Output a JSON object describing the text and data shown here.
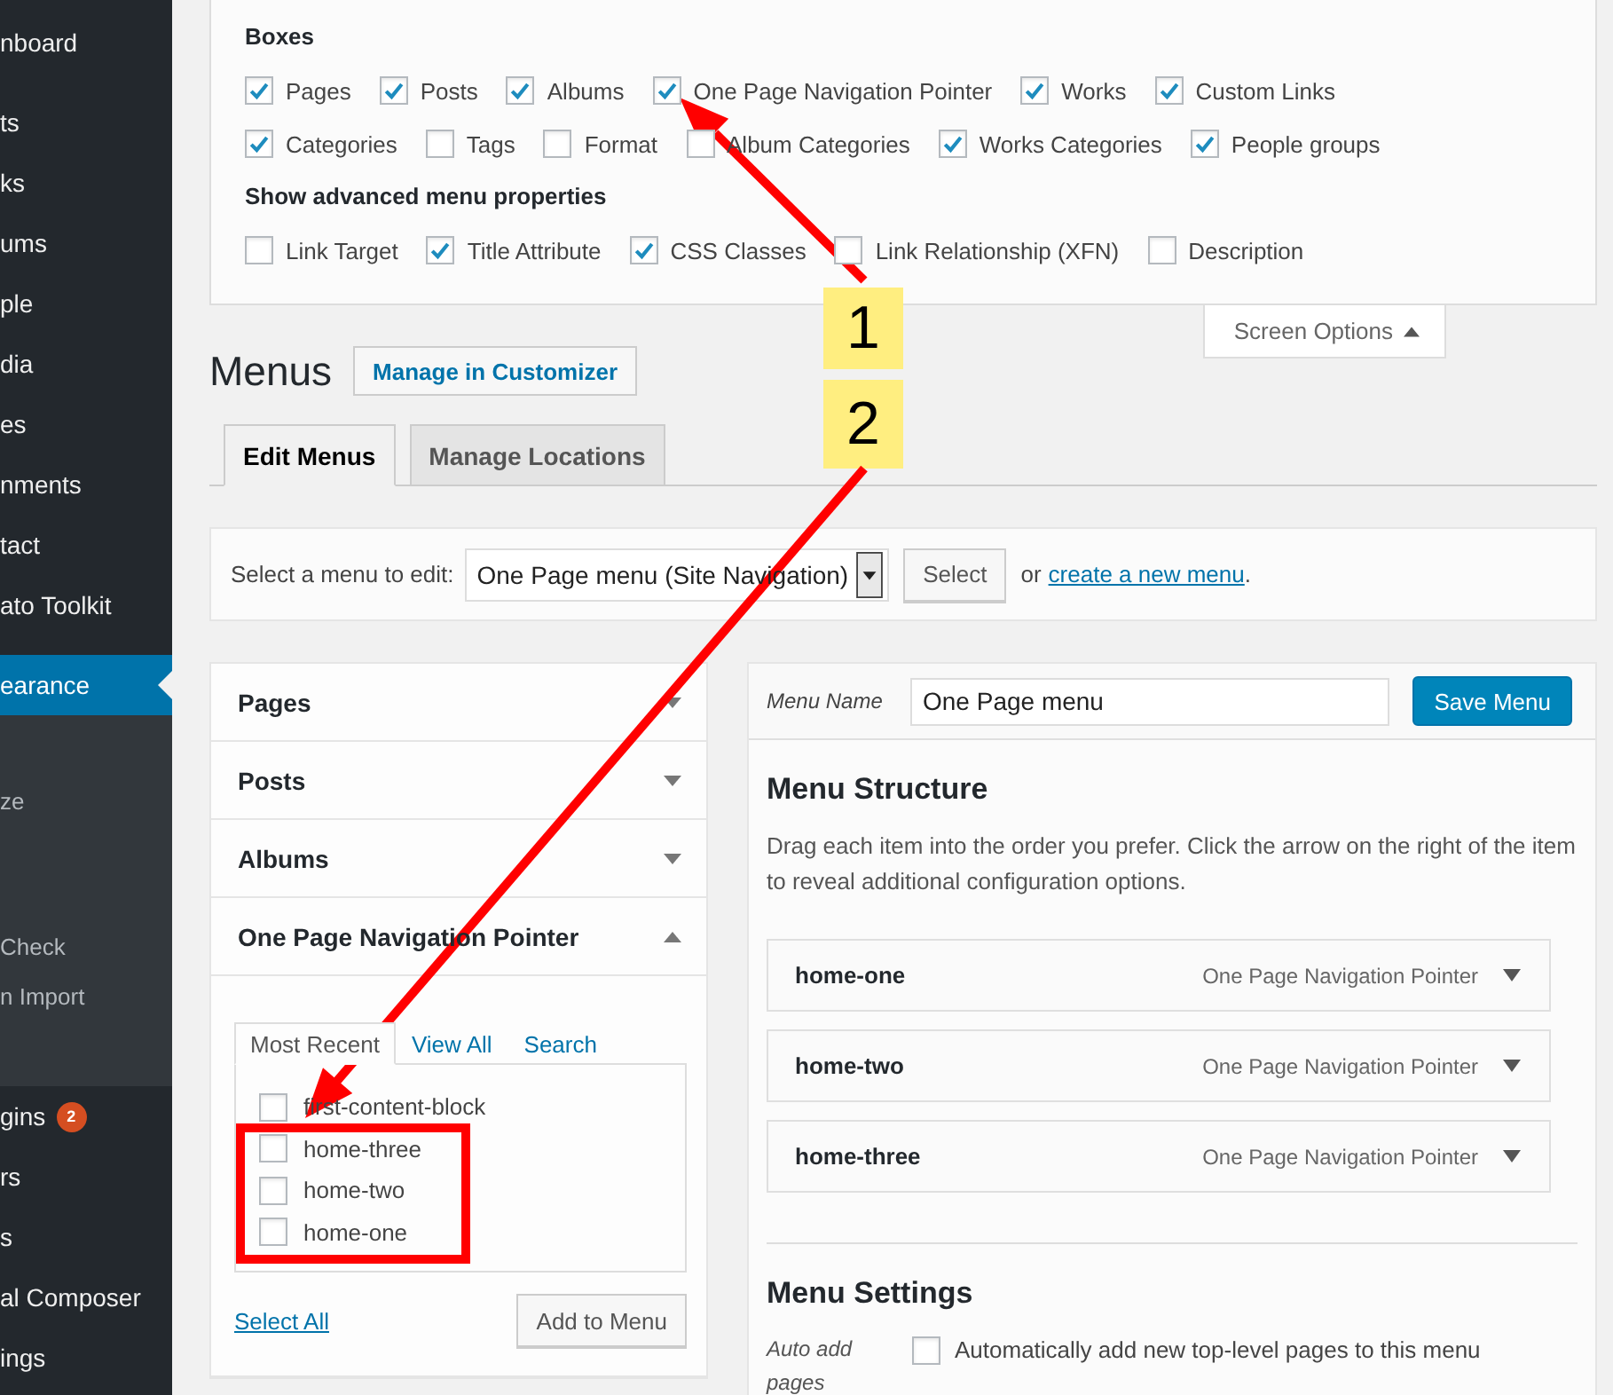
{
  "sidebar": {
    "items": [
      {
        "label": "nboard",
        "selected": false
      },
      {
        "label": "ts",
        "selected": false
      },
      {
        "label": "ks",
        "selected": false
      },
      {
        "label": "ums",
        "selected": false
      },
      {
        "label": "ple",
        "selected": false
      },
      {
        "label": "dia",
        "selected": false
      },
      {
        "label": "es",
        "selected": false
      },
      {
        "label": "nments",
        "selected": false
      },
      {
        "label": "tact",
        "selected": false
      },
      {
        "label": "ato Toolkit",
        "selected": false
      },
      {
        "label": "earance",
        "selected": true,
        "children": [
          "ze",
          "Check",
          "n Import"
        ]
      },
      {
        "label": "gins",
        "selected": false,
        "badge": "2"
      },
      {
        "label": "rs",
        "selected": false
      },
      {
        "label": "s",
        "selected": false
      },
      {
        "label": "al Composer",
        "selected": false
      },
      {
        "label": "ings",
        "selected": false
      }
    ]
  },
  "screen_options": {
    "boxes_heading": "Boxes",
    "boxes": [
      {
        "label": "Pages",
        "checked": true
      },
      {
        "label": "Posts",
        "checked": true
      },
      {
        "label": "Albums",
        "checked": true
      },
      {
        "label": "One Page Navigation Pointer",
        "checked": true
      },
      {
        "label": "Works",
        "checked": true
      },
      {
        "label": "Custom Links",
        "checked": true
      },
      {
        "label": "Categories",
        "checked": true
      },
      {
        "label": "Tags",
        "checked": false
      },
      {
        "label": "Format",
        "checked": false
      },
      {
        "label": "Album Categories",
        "checked": false
      },
      {
        "label": "Works Categories",
        "checked": true
      },
      {
        "label": "People groups",
        "checked": true
      }
    ],
    "advanced_heading": "Show advanced menu properties",
    "advanced": [
      {
        "label": "Link Target",
        "checked": false
      },
      {
        "label": "Title Attribute",
        "checked": true
      },
      {
        "label": "CSS Classes",
        "checked": true
      },
      {
        "label": "Link Relationship (XFN)",
        "checked": false
      },
      {
        "label": "Description",
        "checked": false
      }
    ],
    "tab": {
      "label": "Screen Options",
      "expanded": true
    }
  },
  "title": "Menus",
  "customizer_button": "Manage in Customizer",
  "tabs": [
    {
      "label": "Edit Menus",
      "selected": true
    },
    {
      "label": "Manage Locations",
      "selected": false
    }
  ],
  "select_bar": {
    "label": "Select a menu to edit:",
    "value": "One Page menu (Site Navigation)",
    "button": "Select",
    "or_text": "or",
    "link": "create a new menu",
    "after": "."
  },
  "add_items": {
    "sections": [
      {
        "title": "Pages",
        "expanded": false
      },
      {
        "title": "Posts",
        "expanded": false
      },
      {
        "title": "Albums",
        "expanded": false
      },
      {
        "title": "One Page Navigation Pointer",
        "expanded": true,
        "tabs": [
          {
            "label": "Most Recent",
            "selected": true
          },
          {
            "label": "View All",
            "selected": false
          },
          {
            "label": "Search",
            "selected": false
          }
        ],
        "items": [
          {
            "label": "first-content-block",
            "checked": false
          },
          {
            "label": "home-three",
            "checked": false
          },
          {
            "label": "home-two",
            "checked": false
          },
          {
            "label": "home-one",
            "checked": false
          }
        ],
        "select_all": "Select All",
        "add_button": "Add to Menu"
      }
    ]
  },
  "menu_editor": {
    "name_label": "Menu Name",
    "name_value": "One Page menu",
    "save_button": "Save Menu",
    "structure_heading": "Menu Structure",
    "structure_text": "Drag each item into the order you prefer. Click the arrow on the right of the item to reveal additional configuration options.",
    "items": [
      {
        "title": "home-one",
        "type": "One Page Navigation Pointer"
      },
      {
        "title": "home-two",
        "type": "One Page Navigation Pointer"
      },
      {
        "title": "home-three",
        "type": "One Page Navigation Pointer"
      }
    ],
    "settings_heading": "Menu Settings",
    "auto_add_label": "Auto add pages",
    "auto_add": {
      "label": "Automatically add new top-level pages to this menu",
      "checked": false
    }
  },
  "annotations": [
    {
      "label": "1"
    },
    {
      "label": "2"
    }
  ]
}
